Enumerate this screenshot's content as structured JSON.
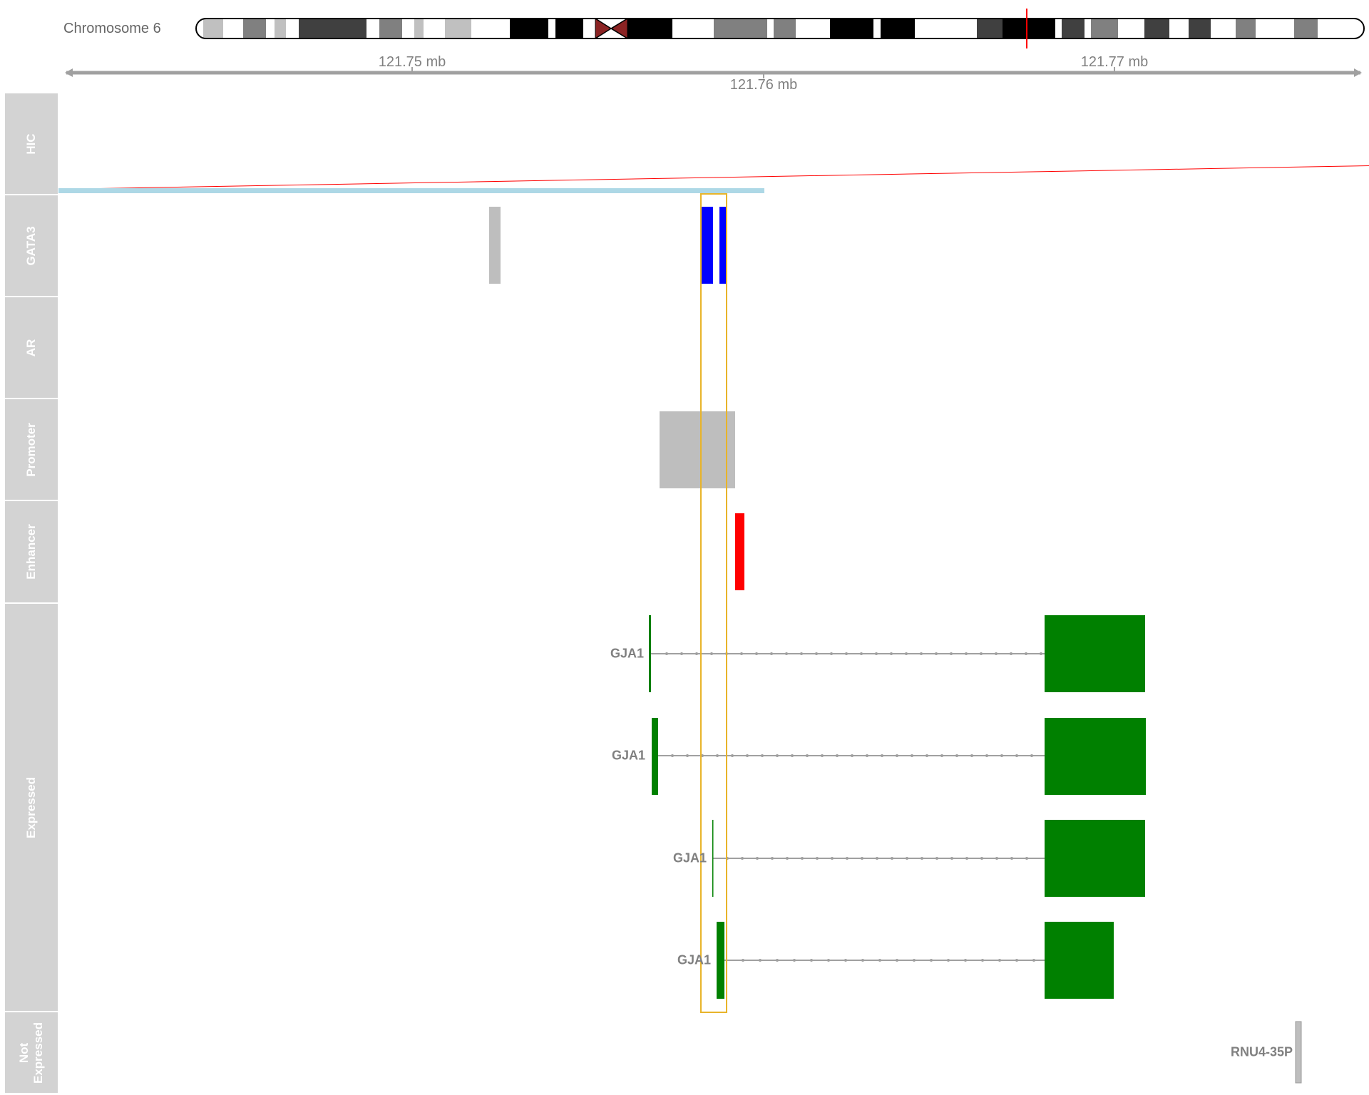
{
  "ideogram": {
    "chromosome_label": "Chromosome 6",
    "colors": {
      "outline": "#000000",
      "centromere": "#8b2323",
      "highlight": "#ff0000"
    }
  },
  "axis": {
    "tick_labels": [
      "121.75 mb",
      "121.76 mb",
      "121.77 mb"
    ],
    "range_mb": [
      121.74,
      121.778
    ],
    "color": "#a0a0a0"
  },
  "tracks": [
    {
      "id": "hic",
      "label": "HIC"
    },
    {
      "id": "gata3",
      "label": "GATA3"
    },
    {
      "id": "ar",
      "label": "AR"
    },
    {
      "id": "promoter",
      "label": "Promoter"
    },
    {
      "id": "enhancer",
      "label": "Enhancer"
    },
    {
      "id": "expressed",
      "label": "Expressed"
    },
    {
      "id": "not_expressed",
      "label": "Not\nExpressed"
    }
  ],
  "genes": {
    "expressed": [
      "GJA1",
      "GJA1",
      "GJA1",
      "GJA1"
    ],
    "not_expressed": [
      "RNU4-35P"
    ]
  },
  "colors": {
    "track_panel": "#d3d3d3",
    "hic_link": "#ff0000",
    "hic_anchor": "#add8e6",
    "gata3_peak": "#0000ff",
    "gray_feature": "#bebebe",
    "enhancer": "#ff0000",
    "gene_expressed": "#008000",
    "intron_line": "#a0a0a0",
    "highlight_box": "#e8b42a"
  }
}
